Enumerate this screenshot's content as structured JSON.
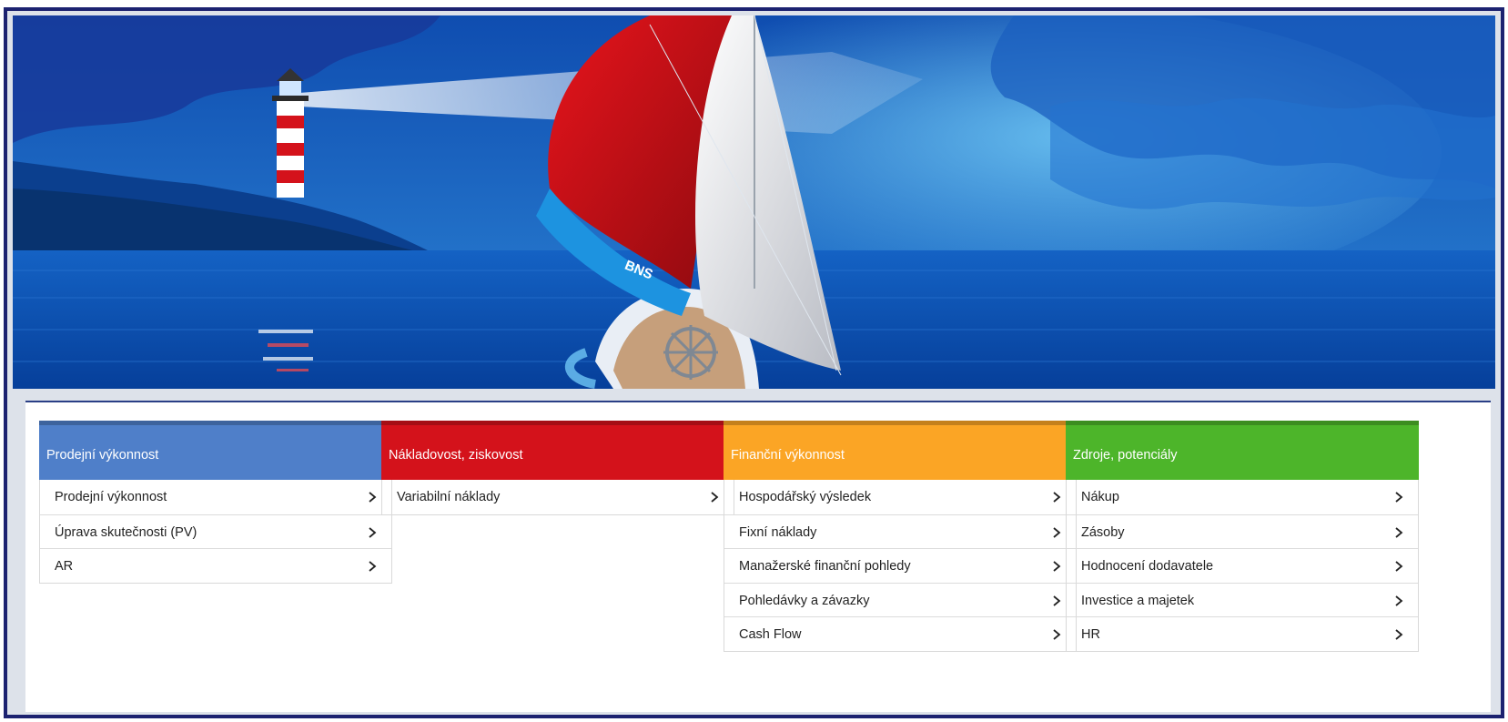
{
  "banner": {
    "boat_label": "BNS",
    "colors": {
      "sky": "#0f56b4",
      "sea": "#0a4aa8",
      "sail_red": "#d4121b",
      "sail_white": "#e8e8e8"
    }
  },
  "columns": [
    {
      "title": "Prodejní výkonnost",
      "color": "#4f7fc9",
      "items": [
        "Prodejní výkonnost",
        "Úprava skutečnosti (PV)",
        "AR"
      ]
    },
    {
      "title": "Nákladovost, ziskovost",
      "color": "#d4121b",
      "items": [
        "Variabilní náklady"
      ]
    },
    {
      "title": "Finanční výkonnost",
      "color": "#fba525",
      "items": [
        "Hospodářský výsledek",
        "Fixní náklady",
        "Manažerské finanční pohledy",
        "Pohledávky a závazky",
        "Cash Flow"
      ]
    },
    {
      "title": "Zdroje, potenciály",
      "color": "#4db52a",
      "items": [
        "Nákup",
        "Zásoby",
        "Hodnocení dodavatele",
        "Investice a majetek",
        "HR"
      ]
    }
  ],
  "icons": {
    "row_arrow": "chevron-right-icon"
  }
}
